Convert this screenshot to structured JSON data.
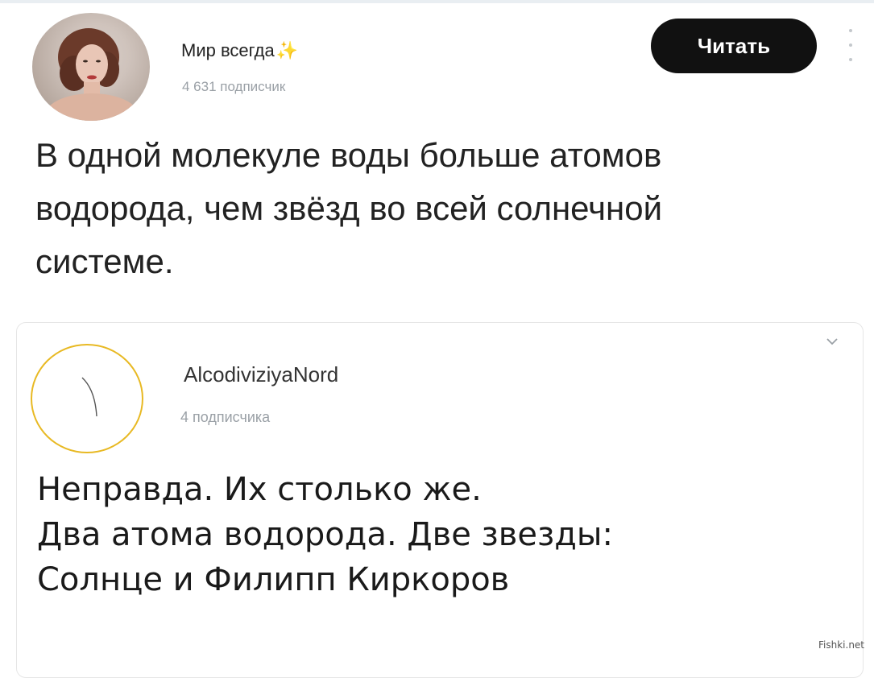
{
  "post1": {
    "author_name": "Мир всегда",
    "author_sparkle": "✨",
    "subscribers": "4 631 подписчик",
    "follow_button_label": "Читать",
    "text_lines": [
      "В одной молекуле воды больше атомов",
      "водорода, чем звёзд во всей солнечной",
      "системе."
    ]
  },
  "post2": {
    "author_name": "AlcodiviziyaNord",
    "subscribers": "4 подписчика",
    "text_lines": [
      "Неправда. Их столько же.",
      "Два атома водорода. Две звезды:",
      "Солнце и Филипп Киркоров"
    ]
  },
  "watermark": "Fishki.net",
  "icons": {
    "more": "more-vertical-icon",
    "chevron": "chevron-down-icon"
  },
  "colors": {
    "button_bg": "#111111",
    "avatar2_border": "#e8b923",
    "muted_text": "#9aa0a6"
  }
}
